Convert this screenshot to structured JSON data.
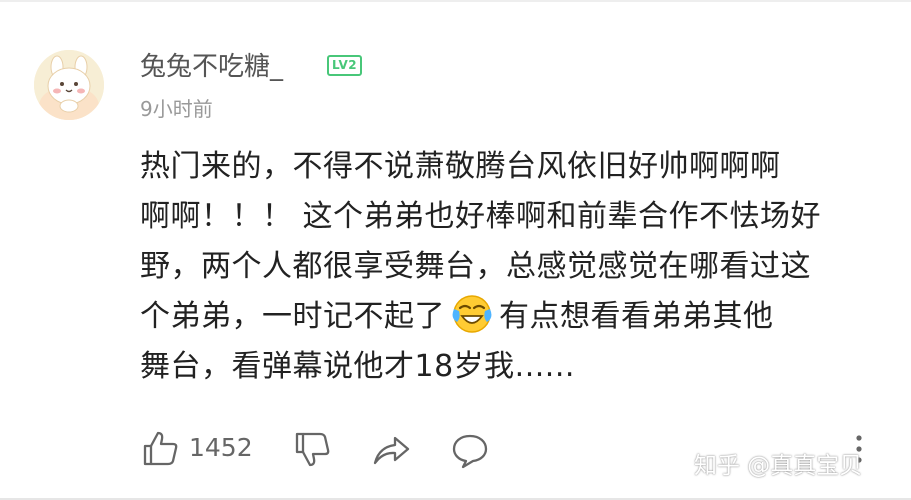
{
  "comment": {
    "author": {
      "name": "兔兔不吃糖_",
      "level_badge": "LV2",
      "avatar": "bunny-avatar"
    },
    "time": "9小时前",
    "lines": [
      "热门来的，不得不说萧敬腾台风依旧好帅啊啊啊",
      "啊啊！！！ 这个弟弟也好棒啊和前辈合作不怯场好",
      "野，两个人都很享受舞台，总感觉感觉在哪看过这",
      "个弟弟，一时记不起了",
      "有点想看看弟弟其他",
      "舞台，看弹幕说他才18岁我......"
    ],
    "emoji": "tears-of-joy-emoji",
    "actions": {
      "like_count": "1452"
    }
  },
  "watermark": "知乎 @真真宝贝",
  "colors": {
    "badge_green": "#48c779",
    "text_primary": "#222222",
    "text_secondary": "#999999",
    "icon_gray": "#666666"
  }
}
